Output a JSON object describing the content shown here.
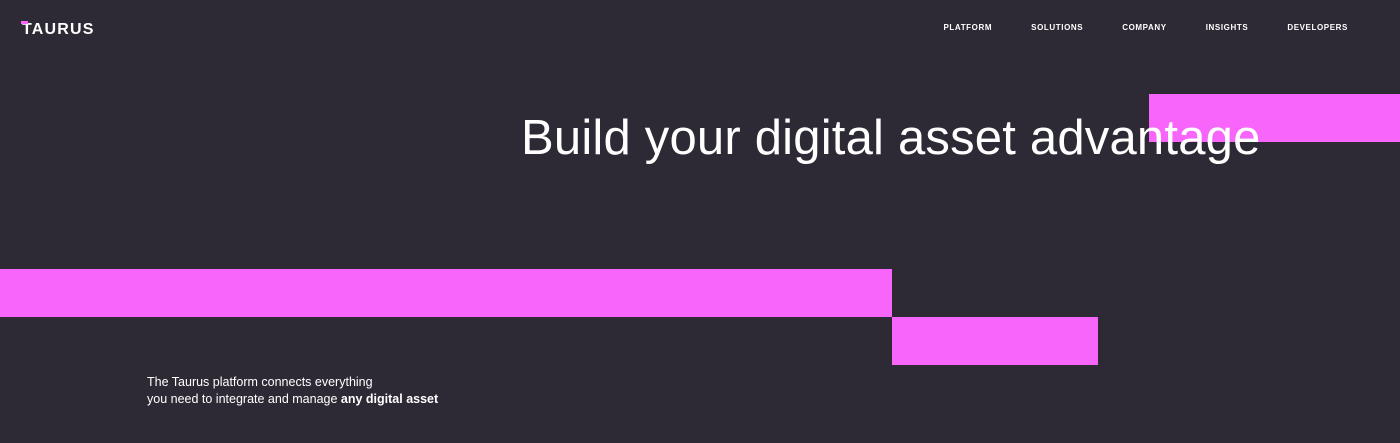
{
  "brand": {
    "name": "TAURUS",
    "accent": "#f865fb",
    "background": "#2e2a35"
  },
  "nav": {
    "items": [
      {
        "label": "PLATFORM"
      },
      {
        "label": "SOLUTIONS"
      },
      {
        "label": "COMPANY"
      },
      {
        "label": "INSIGHTS"
      },
      {
        "label": "DEVELOPERS"
      }
    ]
  },
  "hero": {
    "headline": "Build your digital asset advantage",
    "tagline_line1": "The Taurus platform connects everything",
    "tagline_line2_prefix": "you need to integrate and manage ",
    "tagline_line2_bold": "any digital asset"
  }
}
